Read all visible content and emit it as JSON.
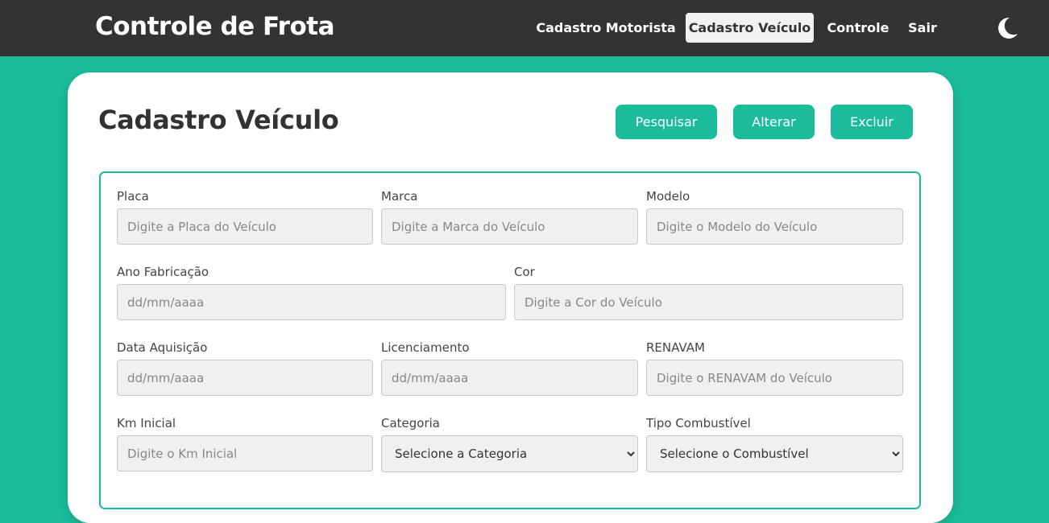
{
  "header": {
    "brand": "Controle de Frota",
    "nav": [
      {
        "label": "Cadastro Motorista",
        "active": false
      },
      {
        "label": "Cadastro Veículo",
        "active": true
      },
      {
        "label": "Controle",
        "active": false
      },
      {
        "label": "Sair",
        "active": false
      }
    ],
    "theme_icon": "moon-icon"
  },
  "page": {
    "title": "Cadastro Veículo",
    "actions": {
      "search": "Pesquisar",
      "edit": "Alterar",
      "delete": "Excluir"
    }
  },
  "form": {
    "placa": {
      "label": "Placa",
      "placeholder": "Digite a Placa do Veículo",
      "value": ""
    },
    "marca": {
      "label": "Marca",
      "placeholder": "Digite a Marca do Veículo",
      "value": ""
    },
    "modelo": {
      "label": "Modelo",
      "placeholder": "Digite o Modelo do Veículo",
      "value": ""
    },
    "ano_fabricacao": {
      "label": "Ano Fabricação",
      "placeholder": "dd/mm/aaaa",
      "value": ""
    },
    "cor": {
      "label": "Cor",
      "placeholder": "Digite a Cor do Veículo",
      "value": ""
    },
    "data_aquisicao": {
      "label": "Data Aquisição",
      "placeholder": "dd/mm/aaaa",
      "value": ""
    },
    "licenciamento": {
      "label": "Licenciamento",
      "placeholder": "dd/mm/aaaa",
      "value": ""
    },
    "renavam": {
      "label": "RENAVAM",
      "placeholder": "Digite o RENAVAM do Veículo",
      "value": ""
    },
    "km_inicial": {
      "label": "Km Inicial",
      "placeholder": "Digite o Km Inicial",
      "value": ""
    },
    "categoria": {
      "label": "Categoria",
      "selected": "Selecione a Categoria"
    },
    "tipo_combustivel": {
      "label": "Tipo Combustível",
      "selected": "Selecione o Combustível"
    }
  },
  "colors": {
    "accent": "#1abc9c",
    "header_bg": "#333333"
  }
}
